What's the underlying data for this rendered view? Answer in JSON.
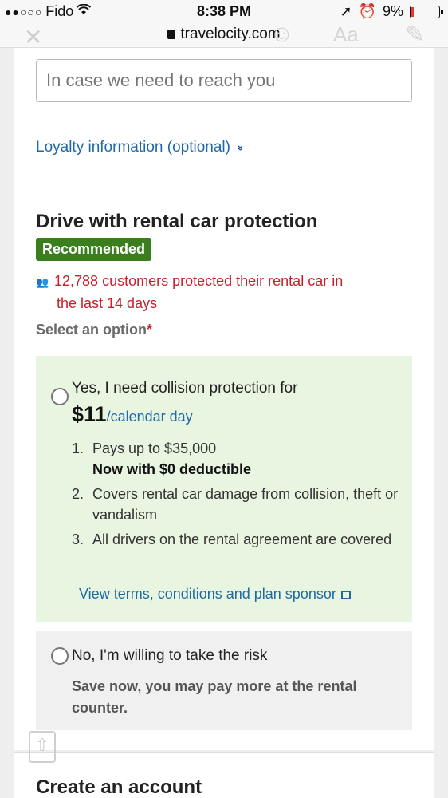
{
  "status_bar": {
    "signal": "●●○○○",
    "carrier": "Fido",
    "wifi_icon": "wifi-icon",
    "time": "8:38 PM",
    "battery_text": "9%",
    "battery_level": 0.09
  },
  "browser": {
    "close_glyph": "✕",
    "url": "travelocity.com",
    "reader_label": "Aa"
  },
  "contact": {
    "phone_placeholder": "In case we need to reach you",
    "loyalty_link": "Loyalty information (optional)"
  },
  "protection": {
    "title": "Drive with rental car protection",
    "badge": "Recommended",
    "social_proof_line1": "12,788 customers protected their rental car in",
    "social_proof_line2": "the last 14 days",
    "select_label": "Select an option",
    "required_mark": "*",
    "yes_option": {
      "label": "Yes, I need collision protection for",
      "price": "$11",
      "price_unit": "/calendar day",
      "items": [
        {
          "num": "1.",
          "text": "Pays up to $35,000",
          "bold": "Now with $0 deductible"
        },
        {
          "num": "2.",
          "text": "Covers rental car damage from collision, theft or vandalism",
          "bold": ""
        },
        {
          "num": "3.",
          "text": "All drivers on the rental agreement are covered",
          "bold": ""
        }
      ],
      "terms_link": "View terms, conditions and plan sponsor"
    },
    "no_option": {
      "label": "No, I'm willing to take the risk",
      "sub": "Save now, you may pay more at the rental counter."
    }
  },
  "account": {
    "title": "Create an account"
  },
  "colors": {
    "accent_link": "#1f6aa5",
    "badge_green": "#3a7e1d",
    "alert_red": "#c8202d",
    "option_green_bg": "#e8f5e1"
  }
}
